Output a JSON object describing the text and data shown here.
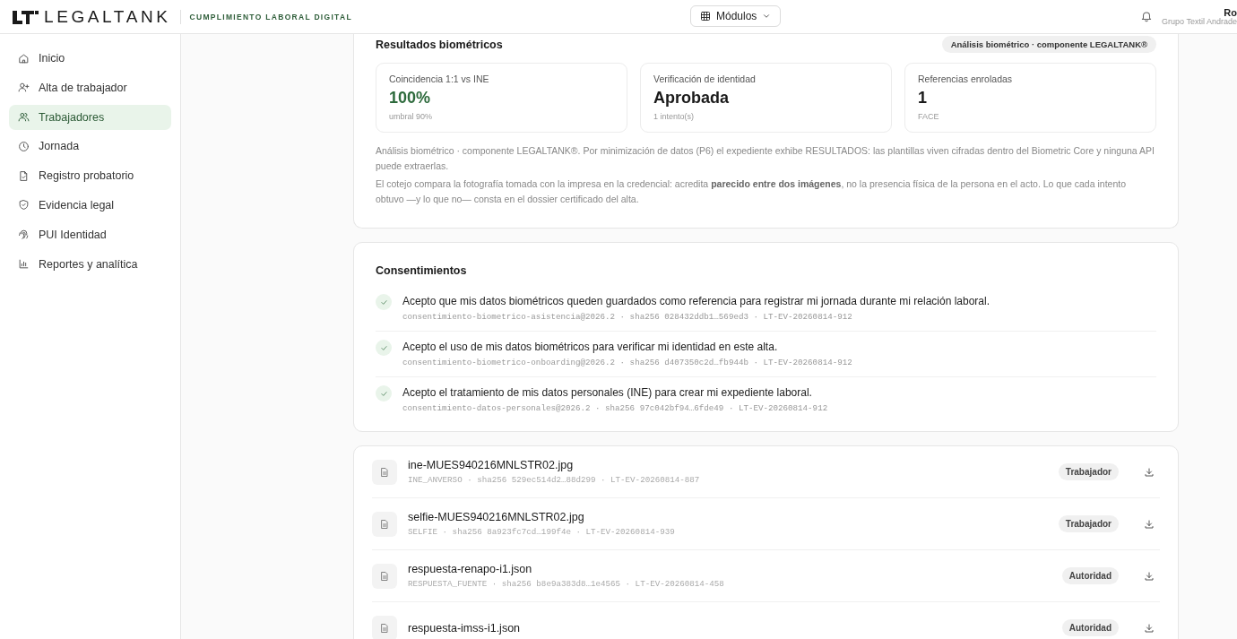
{
  "header": {
    "brand": "LEGALTANK",
    "tagline": "CUMPLIMIENTO LABORAL DIGITAL",
    "modules_button": "Módulos",
    "user_name": "Ro",
    "user_org": "Grupo Textil Andrade"
  },
  "sidebar": {
    "items": [
      {
        "label": "Inicio",
        "selected": false
      },
      {
        "label": "Alta de trabajador",
        "selected": false
      },
      {
        "label": "Trabajadores",
        "selected": true
      },
      {
        "label": "Jornada",
        "selected": false
      },
      {
        "label": "Registro probatorio",
        "selected": false
      },
      {
        "label": "Evidencia legal",
        "selected": false
      },
      {
        "label": "PUI Identidad",
        "selected": false
      },
      {
        "label": "Reportes y analítica",
        "selected": false
      }
    ]
  },
  "biometrics": {
    "title": "Resultados biométricos",
    "badge": "Análisis biométrico · componente LEGALTANK®",
    "metrics": [
      {
        "label": "Coincidencia 1:1 vs INE",
        "value": "100%",
        "sub": "umbral 90%",
        "kind": "success"
      },
      {
        "label": "Verificación de identidad",
        "value": "Aprobada",
        "sub": "1 intento(s)",
        "kind": "plain"
      },
      {
        "label": "Referencias enroladas",
        "value": "1",
        "sub": "FACE",
        "kind": "plain"
      }
    ],
    "notes": [
      "Análisis biométrico · componente LEGALTANK®. Por minimización de datos (P6) el expediente exhibe RESULTADOS: las plantillas viven cifradas dentro del Biometric Core y ninguna API puede extraerlas.",
      "El cotejo compara la fotografía tomada con la impresa en la credencial: acredita **parecido entre dos imágenes**, no la presencia física de la persona en el acto. Lo que cada intento obtuvo —y lo que no— consta en el dossier certificado del alta."
    ]
  },
  "consents": {
    "title": "Consentimientos",
    "items": [
      {
        "text": "Acepto que mis datos biométricos queden guardados como referencia para registrar mi jornada durante mi relación laboral.",
        "meta": "consentimiento-biometrico-asistencia@2026.2 · sha256 028432ddb1…569ed3 · LT-EV-20260814-912",
        "checked": true
      },
      {
        "text": "Acepto el uso de mis datos biométricos para verificar mi identidad en este alta.",
        "meta": "consentimiento-biometrico-onboarding@2026.2 · sha256 d407350c2d…fb944b · LT-EV-20260814-912",
        "checked": true
      },
      {
        "text": "Acepto el tratamiento de mis datos personales (INE) para crear mi expediente laboral.",
        "meta": "consentimiento-datos-personales@2026.2 · sha256 97c042bf94…6fde49 · LT-EV-20260814-912",
        "checked": true
      }
    ]
  },
  "files": [
    {
      "name": "ine-MUES940216MNLSTR02.jpg",
      "meta": "INE_ANVERSO · sha256 529ec514d2…88d299 · LT-EV-20260814-887",
      "source": "Trabajador"
    },
    {
      "name": "selfie-MUES940216MNLSTR02.jpg",
      "meta": "SELFIE · sha256 8a923fc7cd…199f4e · LT-EV-20260814-939",
      "source": "Trabajador"
    },
    {
      "name": "respuesta-renapo-i1.json",
      "meta": "RESPUESTA_FUENTE · sha256 b8e9a383d8…1e4565 · LT-EV-20260814-458",
      "source": "Autoridad"
    },
    {
      "name": "respuesta-imss-i1.json",
      "source": "Autoridad"
    }
  ]
}
